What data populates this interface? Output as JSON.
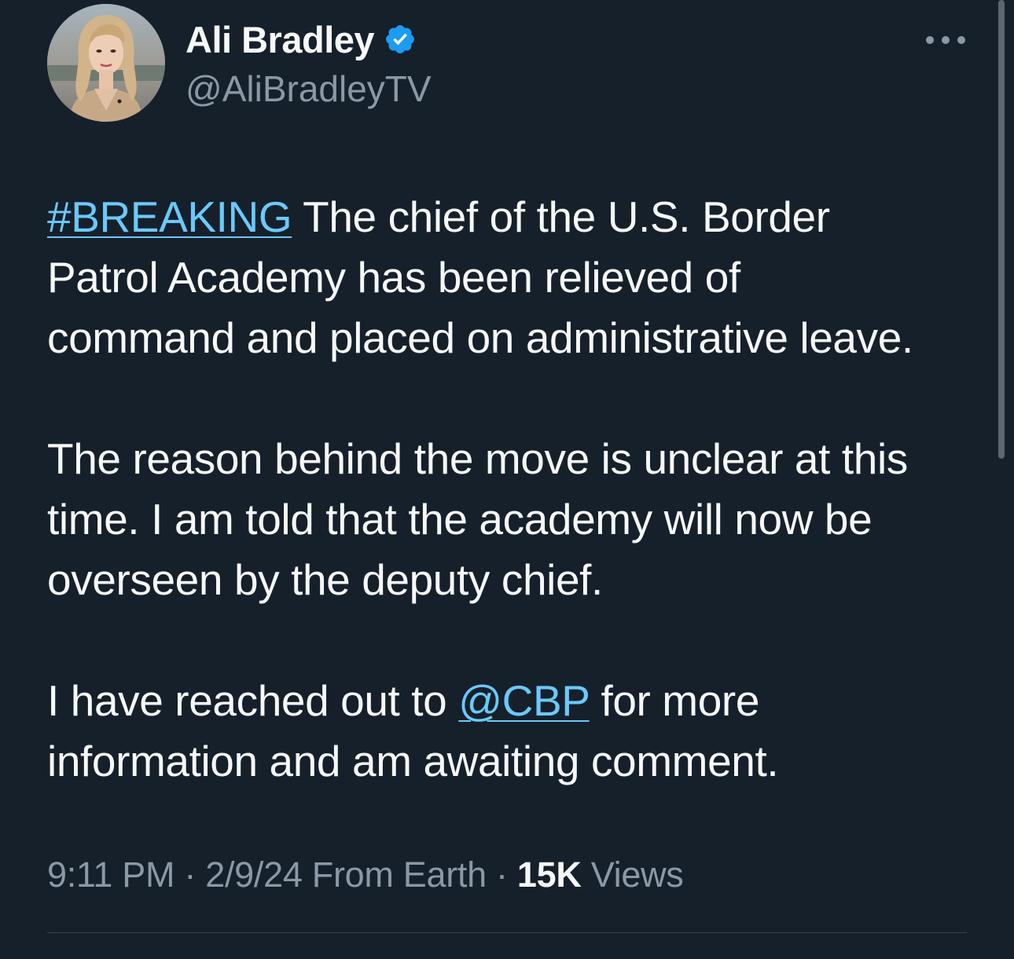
{
  "author": {
    "display_name": "Ali Bradley",
    "handle": "@AliBradleyTV",
    "verified": true,
    "verified_icon": "verified-badge-icon",
    "verified_color": "#1d9bf0"
  },
  "menu": {
    "icon": "more-options-icon"
  },
  "tweet": {
    "p1": {
      "hashtag": "#BREAKING",
      "line1_rest": " The chief of the U.S. Border",
      "line2": "Patrol Academy has been relieved of",
      "line3": "command and placed on administrative leave."
    },
    "p2": {
      "line1": "The reason behind the move is unclear at this",
      "line2": "time. I am told that the academy will now be",
      "line3": "overseen by the deputy chief."
    },
    "p3": {
      "line1_before": "I have reached out to ",
      "mention": "@CBP",
      "line1_after": " for more",
      "line2": "information and am awaiting comment."
    }
  },
  "meta": {
    "time": "9:11 PM",
    "sep1": " · ",
    "date": "2/9/24",
    "source": " From Earth",
    "sep2": " · ",
    "views_count": "15K",
    "views_label": " Views"
  },
  "colors": {
    "background": "#15202b",
    "text": "#f7f9f9",
    "secondary_text": "#8b98a5",
    "link": "#6bc9fb",
    "divider": "#38444d"
  }
}
